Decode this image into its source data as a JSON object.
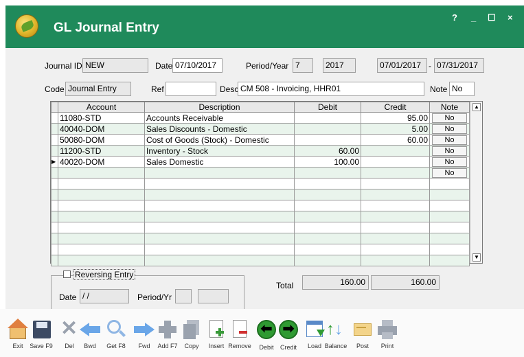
{
  "window": {
    "title": "GL Journal Entry",
    "controls": {
      "help": "?",
      "minimize": "_",
      "maximize": "☐",
      "close": "×"
    }
  },
  "header": {
    "journal_id_label": "Journal ID",
    "journal_id_value": "NEW",
    "date_label": "Date",
    "date_value": "07/10/2017",
    "period_year_label": "Period/Year",
    "period_value": "7",
    "year_value": "2017",
    "range_start": "07/01/2017",
    "range_sep": "-",
    "range_end": "07/31/2017",
    "code_label": "Code",
    "code_value": "Journal Entry",
    "ref_label": "Ref",
    "ref_value": "",
    "desc_label": "Desc",
    "desc_value": "CM 508 - Invoicing, HHR01",
    "note_label": "Note",
    "note_value": "No"
  },
  "grid": {
    "columns": [
      "Account",
      "Description",
      "Debit",
      "Credit",
      "Note"
    ],
    "rows": [
      {
        "account": "11080-STD",
        "description": "Accounts Receivable",
        "debit": "",
        "credit": "95.00",
        "note": "No"
      },
      {
        "account": "40040-DOM",
        "description": "Sales Discounts - Domestic",
        "debit": "",
        "credit": "5.00",
        "note": "No"
      },
      {
        "account": "50080-DOM",
        "description": "Cost of Goods (Stock) - Domestic",
        "debit": "",
        "credit": "60.00",
        "note": "No"
      },
      {
        "account": "11200-STD",
        "description": "Inventory - Stock",
        "debit": "60.00",
        "credit": "",
        "note": "No"
      },
      {
        "account": "40020-DOM",
        "description": "Sales  Domestic",
        "debit": "100.00",
        "credit": "",
        "note": "No"
      },
      {
        "account": "",
        "description": "",
        "debit": "",
        "credit": "",
        "note": "No"
      }
    ],
    "current_row_marker": "▶",
    "empty_row_count": 8
  },
  "reversing": {
    "label": "Reversing Entry",
    "checked": false,
    "date_label": "Date",
    "date_value": "/ /",
    "period_label": "Period/Yr",
    "period_value": "",
    "year_value": ""
  },
  "totals": {
    "label": "Total",
    "debit": "160.00",
    "credit": "160.00"
  },
  "toolbar": [
    {
      "label": "Exit",
      "icon": "home-icon"
    },
    {
      "label": "Save F9",
      "icon": "save-icon"
    },
    {
      "label": "Del",
      "icon": "delete-icon"
    },
    {
      "label": "Bwd",
      "icon": "arrow-left-icon"
    },
    {
      "label": "Get F8",
      "icon": "search-icon"
    },
    {
      "label": "Fwd",
      "icon": "arrow-right-icon"
    },
    {
      "label": "Add F7",
      "icon": "add-icon"
    },
    {
      "label": "Copy",
      "icon": "copy-icon"
    },
    {
      "label": "Insert",
      "icon": "insert-icon"
    },
    {
      "label": "Remove",
      "icon": "remove-icon"
    },
    {
      "label": "Debit",
      "icon": "debit-arrow-icon"
    },
    {
      "label": "Credit",
      "icon": "credit-arrow-icon"
    },
    {
      "label": "Load",
      "icon": "load-icon"
    },
    {
      "label": "Balance",
      "icon": "balance-icon"
    },
    {
      "label": "Post",
      "icon": "post-icon"
    },
    {
      "label": "Print",
      "icon": "print-icon"
    }
  ],
  "colors": {
    "titlebar": "#1f8a5b",
    "row_alt": "#e9f4ec",
    "toolbar_blue": "#6aa6e8",
    "toolbar_green": "#2f9a32"
  }
}
